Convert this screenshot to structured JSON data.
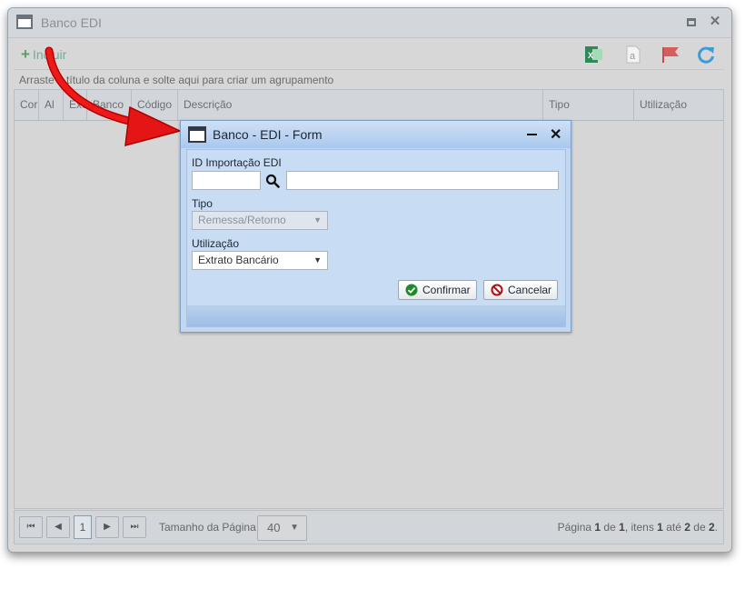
{
  "window": {
    "title": "Banco EDI"
  },
  "toolbar": {
    "add_label": "Incluir",
    "add_icon": "plus-icon"
  },
  "grouping_hint": "Arraste o título da coluna e solte aqui para criar um agrupamento",
  "grid": {
    "columns": [
      "Cor",
      "Al",
      "Exc",
      "Banco",
      "Código",
      "Descrição",
      "Tipo",
      "Utilização"
    ]
  },
  "pager": {
    "current_page": "1",
    "page_size_label": "Tamanho da Página",
    "page_size": "40",
    "info_prefix": "Página",
    "info_page": "1",
    "info_of": "de",
    "info_total_pages": "1",
    "info_items": ", itens",
    "info_from": "1",
    "info_to_word": "até",
    "info_to": "2",
    "info_of2": "de",
    "info_total": "2",
    "info_end": "."
  },
  "dialog": {
    "title": "Banco - EDI - Form",
    "id_label": "ID Importação EDI",
    "id_value": "",
    "desc_value": "",
    "tipo_label": "Tipo",
    "tipo_value": "Remessa/Retorno",
    "util_label": "Utilização",
    "util_value": "Extrato Bancário",
    "confirm_label": "Confirmar",
    "cancel_label": "Cancelar"
  },
  "colors": {
    "accent_arrow": "#e01010",
    "dialog_bg": "#c3d8f0",
    "confirm_icon": "#1e8a2a",
    "cancel_icon": "#b01010"
  }
}
